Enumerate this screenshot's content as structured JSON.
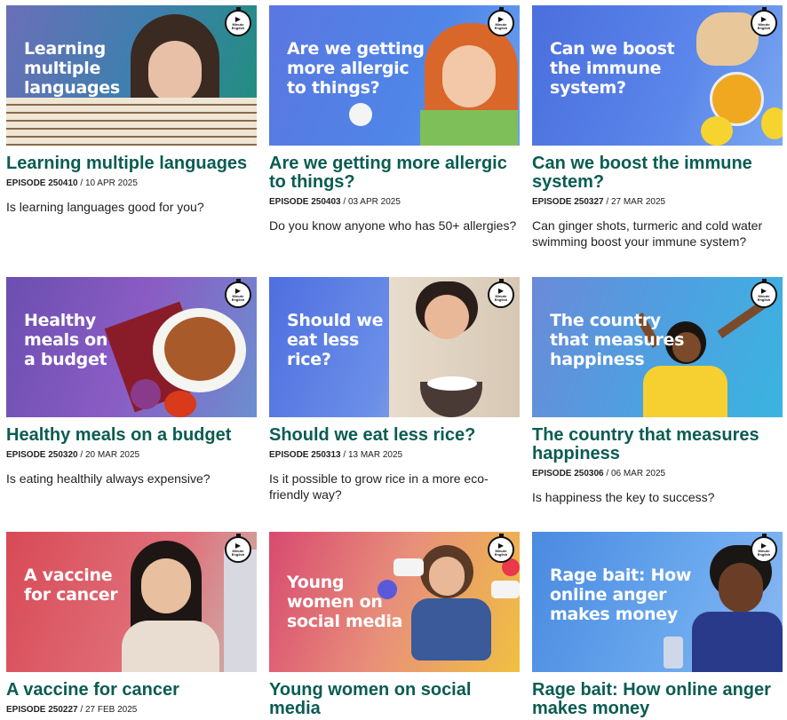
{
  "badge": {
    "label": "Minute English",
    "icon": "play-icon"
  },
  "cards": [
    {
      "thumb_text": "Learning\nmultiple\nlanguages",
      "title": "Learning multiple languages",
      "episode": "EPISODE 250410",
      "date": "10 APR 2025",
      "description": "Is learning languages good for you?"
    },
    {
      "thumb_text": "Are we getting\nmore allergic\nto things?",
      "title": "Are we getting more allergic to things?",
      "episode": "EPISODE 250403",
      "date": "03 APR 2025",
      "description": "Do you know anyone who has 50+ allergies?"
    },
    {
      "thumb_text": "Can we boost\nthe immune\nsystem?",
      "title": "Can we boost the immune system?",
      "episode": "EPISODE 250327",
      "date": "27 MAR 2025",
      "description": "Can ginger shots, turmeric and cold water swimming boost your immune system?"
    },
    {
      "thumb_text": "Healthy\nmeals on\na budget",
      "title": "Healthy meals on a budget",
      "episode": "EPISODE 250320",
      "date": "20 MAR 2025",
      "description": "Is eating healthily always expensive?"
    },
    {
      "thumb_text": "Should we\neat less\nrice?",
      "title": "Should we eat less rice?",
      "episode": "EPISODE 250313",
      "date": "13 MAR 2025",
      "description": "Is it possible to grow rice in a more eco-friendly way?"
    },
    {
      "thumb_text": "The country\nthat measures\nhappiness",
      "title": "The country that measures happiness",
      "episode": "EPISODE 250306",
      "date": "06 MAR 2025",
      "description": "Is happiness the key to success?"
    },
    {
      "thumb_text": "A vaccine\nfor cancer",
      "title": "A vaccine for cancer",
      "episode": "EPISODE 250227",
      "date": "27 FEB 2025",
      "description": ""
    },
    {
      "thumb_text": "Young\nwomen on\nsocial media",
      "title": "Young women on social media",
      "episode": "",
      "date": "",
      "description": ""
    },
    {
      "thumb_text": "Rage bait: How\nonline anger\nmakes money",
      "title": "Rage bait: How online anger makes money",
      "episode": "",
      "date": "",
      "description": ""
    }
  ]
}
